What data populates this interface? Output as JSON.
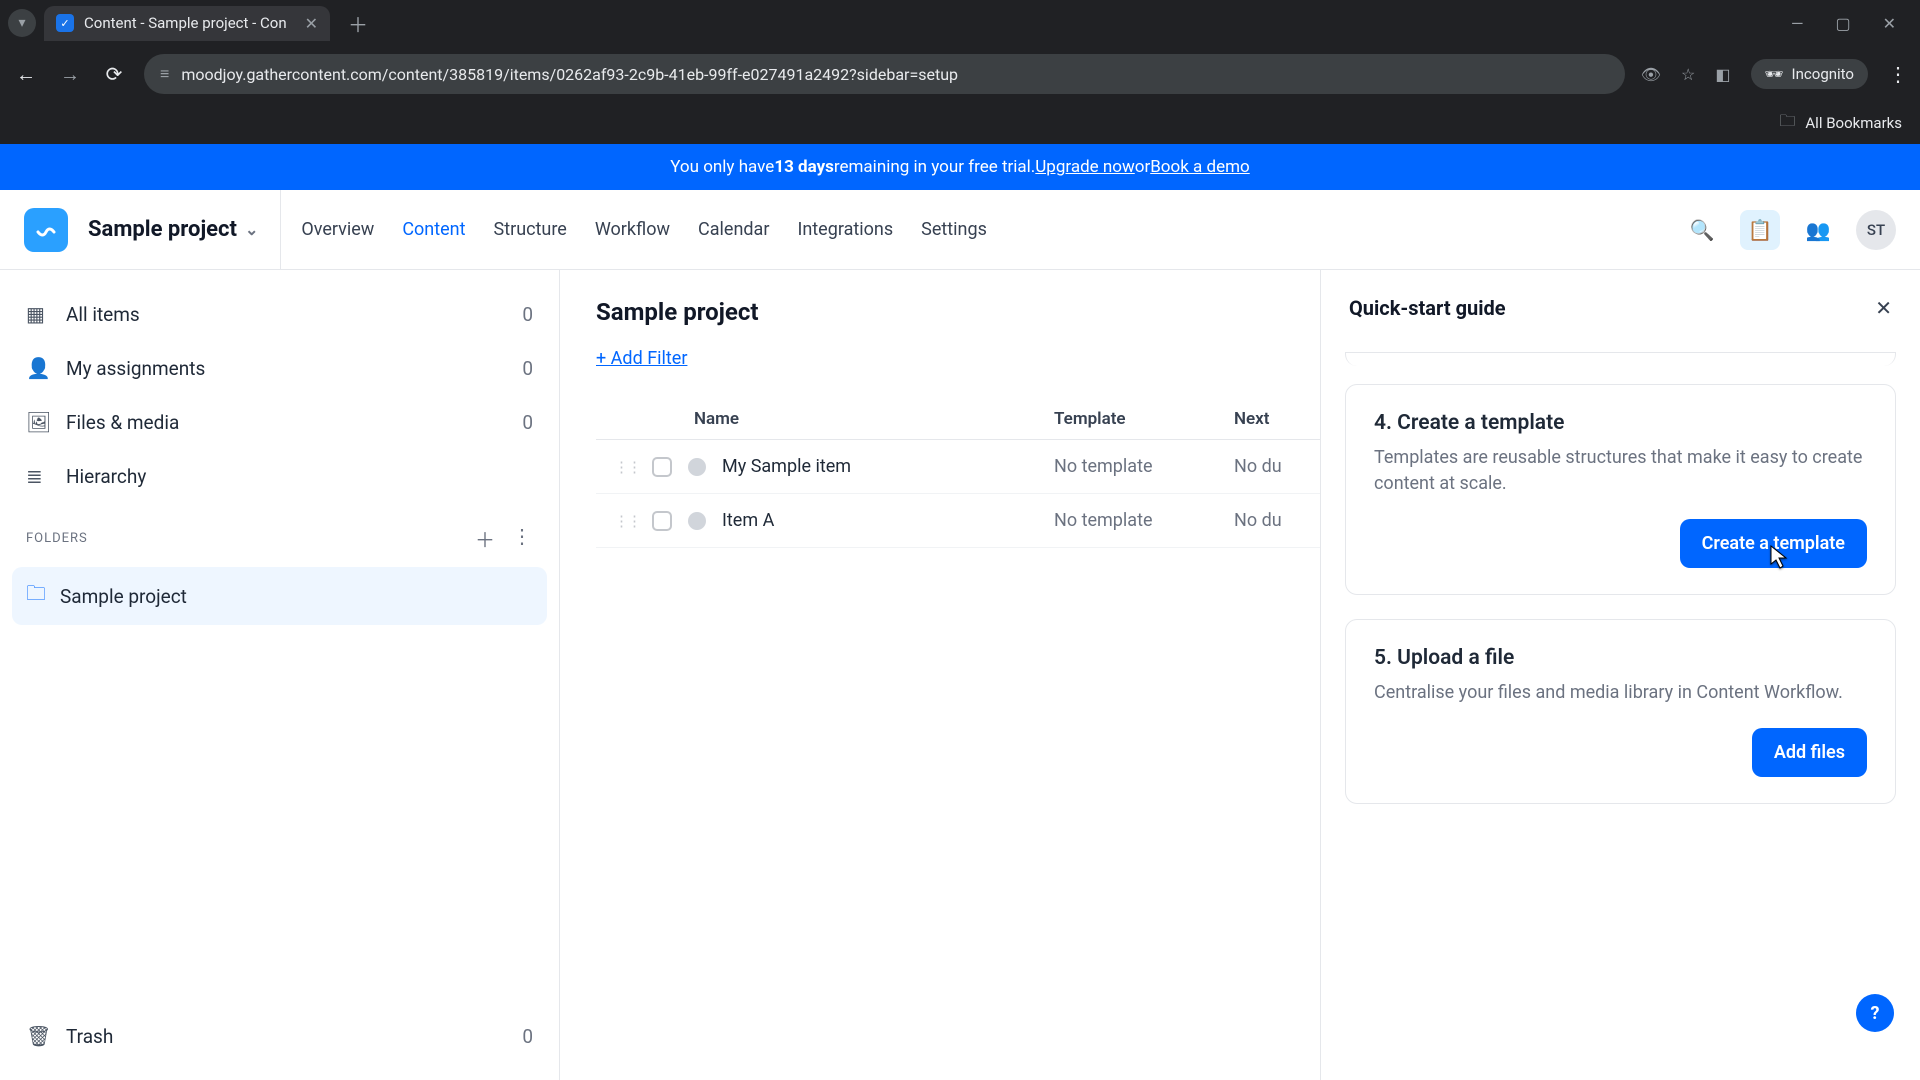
{
  "browser": {
    "tab_title": "Content - Sample project - Con",
    "url": "moodjoy.gathercontent.com/content/385819/items/0262af93-2c9b-41eb-99ff-e027491a2492?sidebar=setup",
    "incognito_label": "Incognito",
    "bookmarks_label": "All Bookmarks"
  },
  "banner": {
    "prefix": "You only have ",
    "days": "13 days",
    "middle": " remaining in your free trial. ",
    "upgrade": "Upgrade now",
    "or": " or ",
    "demo": "Book a demo"
  },
  "topnav": {
    "project_name": "Sample project",
    "items": [
      "Overview",
      "Content",
      "Structure",
      "Workflow",
      "Calendar",
      "Integrations",
      "Settings"
    ],
    "active_index": 1,
    "avatar_initials": "ST"
  },
  "sidebar": {
    "items": [
      {
        "label": "All items",
        "count": "0",
        "icon": "grid"
      },
      {
        "label": "My assignments",
        "count": "0",
        "icon": "user"
      },
      {
        "label": "Files & media",
        "count": "0",
        "icon": "image"
      },
      {
        "label": "Hierarchy",
        "count": "",
        "icon": "list"
      }
    ],
    "folders_heading": "FOLDERS",
    "folders": [
      {
        "label": "Sample project"
      }
    ],
    "trash": {
      "label": "Trash",
      "count": "0"
    }
  },
  "main": {
    "title": "Sample project",
    "add_filter": "+ Add Filter",
    "columns": {
      "name": "Name",
      "template": "Template",
      "next": "Next"
    },
    "rows": [
      {
        "name": "My Sample item",
        "template": "No template",
        "next": "No du"
      },
      {
        "name": "Item A",
        "template": "No template",
        "next": "No du"
      }
    ]
  },
  "panel": {
    "title": "Quick-start guide",
    "cards": [
      {
        "title": "4. Create a template",
        "desc": "Templates are reusable structures that make it easy to create content at scale.",
        "cta": "Create a template"
      },
      {
        "title": "5. Upload a file",
        "desc": "Centralise your files and media library in Content Workflow.",
        "cta": "Add files"
      }
    ]
  }
}
